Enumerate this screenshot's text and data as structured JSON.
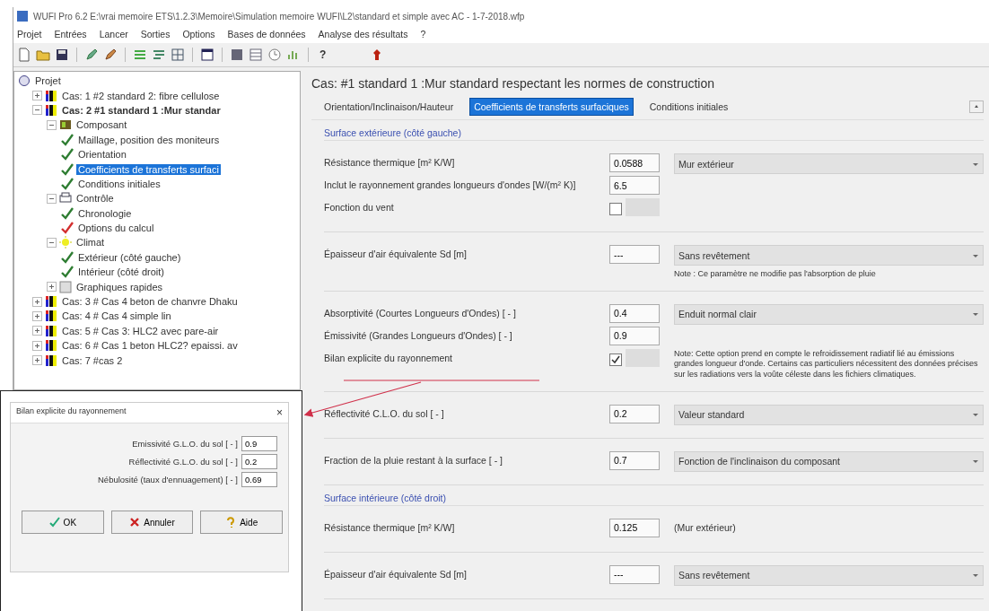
{
  "window": {
    "title": "WUFI Pro 6.2    E:\\vrai memoire ETS\\1.2.3\\Memoire\\Simulation memoire WUFI\\L2\\standard et simple avec AC - 1-7-2018.wfp"
  },
  "menu": [
    "Projet",
    "Entrées",
    "Lancer",
    "Sorties",
    "Options",
    "Bases de données",
    "Analyse des résultats",
    "?"
  ],
  "toolbar": {
    "help_label": "?"
  },
  "tree": [
    {
      "label": "Projet",
      "kind": "root",
      "selected": false,
      "children": [
        {
          "label": "Cas: 1 #2 standard 2: fibre cellulose",
          "kind": "case",
          "bold": false,
          "expanded": false,
          "selected": false
        },
        {
          "label": "Cas: 2 #1 standard  1 :Mur standar",
          "kind": "case",
          "bold": true,
          "expanded": true,
          "selected": false,
          "children": [
            {
              "label": "Composant",
              "kind": "component",
              "expanded": true,
              "selected": false,
              "children": [
                {
                  "label": "Maillage, position des moniteurs",
                  "kind": "check",
                  "color": "#2e7d32",
                  "selected": false
                },
                {
                  "label": "Orientation",
                  "kind": "check",
                  "color": "#2e7d32",
                  "selected": false
                },
                {
                  "label": "Coefficients de transferts surfaci",
                  "kind": "check",
                  "color": "#2e7d32",
                  "selected": true
                },
                {
                  "label": "Conditions initiales",
                  "kind": "check",
                  "color": "#2e7d32",
                  "selected": false
                }
              ]
            },
            {
              "label": "Contrôle",
              "kind": "control",
              "expanded": true,
              "selected": false,
              "children": [
                {
                  "label": "Chronologie",
                  "kind": "check",
                  "color": "#2e7d32",
                  "selected": false
                },
                {
                  "label": "Options du calcul",
                  "kind": "check",
                  "color": "#d32f2f",
                  "selected": false
                }
              ]
            },
            {
              "label": "Climat",
              "kind": "climate",
              "expanded": true,
              "selected": false,
              "children": [
                {
                  "label": "Extérieur (côté gauche)",
                  "kind": "check",
                  "color": "#2e7d32",
                  "selected": false
                },
                {
                  "label": "Intérieur (côté droit)",
                  "kind": "check",
                  "color": "#2e7d32",
                  "selected": false
                }
              ]
            },
            {
              "label": "Graphiques rapides",
              "kind": "graphs",
              "expanded": false,
              "selected": false
            }
          ]
        },
        {
          "label": "Cas: 3 # Cas 4 beton de chanvre Dhaku",
          "kind": "case",
          "bold": false,
          "expanded": false,
          "selected": false
        },
        {
          "label": "Cas: 4 # Cas 4 simple lin",
          "kind": "case",
          "bold": false,
          "expanded": false,
          "selected": false
        },
        {
          "label": "Cas: 5 # Cas 3: HLC2 avec pare-air",
          "kind": "case",
          "bold": false,
          "expanded": false,
          "selected": false
        },
        {
          "label": "Cas: 6 # Cas 1 beton HLC2? epaissi. av",
          "kind": "case",
          "bold": false,
          "expanded": false,
          "selected": false
        },
        {
          "label": "Cas: 7 #cas 2",
          "kind": "case",
          "bold": false,
          "expanded": false,
          "selected": false
        }
      ]
    }
  ],
  "case_title": "Cas:  #1 standard  1 :Mur standard respectant les normes de construction",
  "tabs": [
    {
      "label": "Orientation/Inclinaison/Hauteur",
      "selected": false
    },
    {
      "label": "Coefficients de transferts surfaciques",
      "selected": true
    },
    {
      "label": "Conditions initiales",
      "selected": false
    }
  ],
  "sections": [
    {
      "title": "Surface extérieure (côté gauche)",
      "groups": [
        {
          "rows": [
            {
              "kind": "input",
              "label": "Résistance thermique [m² K/W]",
              "value": "0.0588",
              "dropdown": "Mur extérieur"
            },
            {
              "kind": "input",
              "label": "Inclut le rayonnement grandes longueurs d'ondes [W/(m² K)]",
              "value": "6.5"
            },
            {
              "kind": "checkbox",
              "label": "Fonction du vent",
              "checked": false
            }
          ]
        },
        {
          "rows": [
            {
              "kind": "input",
              "label": "Épaisseur d'air équivalente Sd  [m]",
              "value": "---",
              "dropdown": "Sans revêtement",
              "note": "Note : Ce paramètre ne modifie pas l'absorption de pluie"
            }
          ]
        },
        {
          "rows": [
            {
              "kind": "input",
              "label": "Absorptivité (Courtes Longueurs d'Ondes) [ - ]",
              "value": "0.4",
              "dropdown": "Enduit normal clair"
            },
            {
              "kind": "input",
              "label": "Émissivité (Grandes Longueurs d'Ondes) [ - ]",
              "value": "0.9"
            },
            {
              "kind": "checkbox",
              "label": "Bilan explicite du rayonnement",
              "checked": true,
              "note": "Note: Cette option prend en compte le refroidissement radiatif lié au émissions grandes longueur d'onde. Certains cas particuliers nécessitent des données précises sur les radiations vers la voûte céleste dans les fichiers climatiques."
            }
          ]
        },
        {
          "rows": [
            {
              "kind": "input",
              "label": "Réflectivité C.L.O. du sol [ - ]",
              "value": "0.2",
              "dropdown": "Valeur standard"
            }
          ]
        },
        {
          "rows": [
            {
              "kind": "input",
              "label": "Fraction de la pluie restant à la surface [ - ]",
              "value": "0.7",
              "dropdown": "Fonction de l'inclinaison du composant"
            }
          ]
        }
      ]
    },
    {
      "title": "Surface intérieure (côté droit)",
      "groups": [
        {
          "rows": [
            {
              "kind": "input",
              "label": "Résistance thermique [m² K/W]",
              "value": "0.125",
              "text": "(Mur extérieur)"
            }
          ]
        },
        {
          "rows": [
            {
              "kind": "input",
              "label": "Épaisseur d'air équivalente Sd  [m]",
              "value": "---",
              "dropdown": "Sans revêtement"
            }
          ]
        }
      ]
    }
  ],
  "dialog": {
    "title": "Bilan explicite du rayonnement",
    "close": "×",
    "fields": [
      {
        "label": "Emissivité G.L.O. du sol [ - ]",
        "value": "0.9"
      },
      {
        "label": "Réflectivité G.L.O. du sol [ - ]",
        "value": "0.2"
      },
      {
        "label": "Nébulosité (taux d'ennuagement) [ - ]",
        "value": "0.69"
      }
    ],
    "buttons": [
      {
        "label": "OK",
        "kind": "ok"
      },
      {
        "label": "Annuler",
        "kind": "cancel"
      },
      {
        "label": "Aide",
        "kind": "help"
      }
    ]
  }
}
